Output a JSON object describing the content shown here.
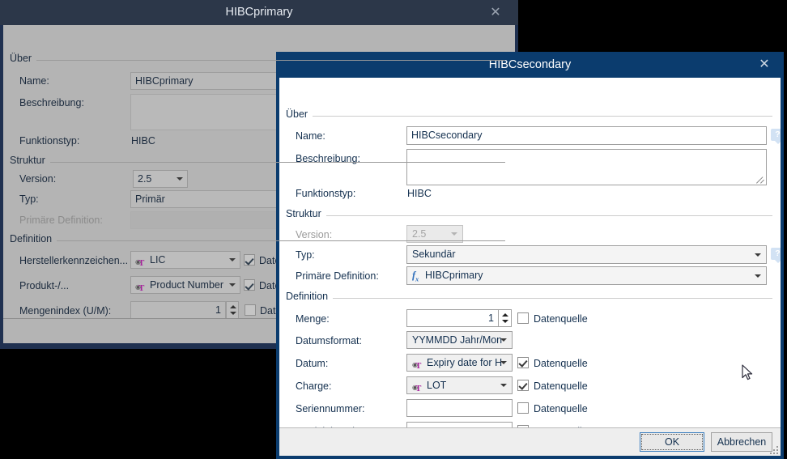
{
  "background_window": {
    "title": "HIBCprimary",
    "close_icon": "close-icon",
    "groups": {
      "about": "Über",
      "structure": "Struktur",
      "definition": "Definition"
    },
    "fields": {
      "name_label": "Name:",
      "name_value": "HIBCprimary",
      "description_label": "Beschreibung:",
      "description_value": "",
      "functiontype_label": "Funktionstyp:",
      "functiontype_value": "HIBC",
      "version_label": "Version:",
      "version_value": "2.5",
      "type_label": "Typ:",
      "type_value": "Primär",
      "primary_def_label": "Primäre Definition:",
      "primary_def_value": "",
      "lic_label": "Herstellerkennzeichen...",
      "lic_value": "LIC",
      "product_label": "Produkt-/...",
      "product_value": "Product Number",
      "uom_label": "Mengenindex (U/M):",
      "uom_value": "1",
      "datasource_label": "Date"
    },
    "checkboxes": [
      {
        "label": "Date",
        "checked": true
      },
      {
        "label": "Date",
        "checked": true
      },
      {
        "label": "Date",
        "checked": false
      }
    ]
  },
  "dialog": {
    "title": "HIBCsecondary",
    "close_icon": "close-icon",
    "groups": {
      "about": "Über",
      "structure": "Struktur",
      "definition": "Definition"
    },
    "about": {
      "name_label": "Name:",
      "name_value": "HIBCsecondary",
      "name_placeholder": "",
      "description_label": "Beschreibung:",
      "description_value": "",
      "functiontype_label": "Funktionstyp:",
      "functiontype_value": "HIBC",
      "help_icon": "?"
    },
    "structure": {
      "version_label": "Version:",
      "version_value": "2.5",
      "type_label": "Typ:",
      "type_value": "Sekundär",
      "primary_def_label": "Primäre Definition:",
      "primary_def_value": "HIBCprimary",
      "primary_def_icon": "fx-icon",
      "help_icon": "?"
    },
    "definition": {
      "rows": [
        {
          "label": "Menge:",
          "value": "1",
          "control": "spinner",
          "datasource_label": "Datenquelle",
          "checked": false
        },
        {
          "label": "Datumsformat:",
          "value": "YYMMDD Jahr/Mon",
          "control": "combo-small",
          "datasource_label": "",
          "checked": null
        },
        {
          "label": "Datum:",
          "value": "Expiry date for H",
          "control": "combo-icon",
          "datasource_label": "Datenquelle",
          "checked": true
        },
        {
          "label": "Charge:",
          "value": "LOT",
          "control": "combo-icon",
          "datasource_label": "Datenquelle",
          "checked": true
        },
        {
          "label": "Seriennummer:",
          "value": "",
          "control": "text",
          "datasource_label": "Datenquelle",
          "checked": false
        },
        {
          "label": "Produktionsdatum:",
          "value": "",
          "control": "text",
          "datasource_label": "Datenquelle",
          "checked": false
        }
      ]
    },
    "footer": {
      "ok_label": "OK",
      "cancel_label": "Abbrechen"
    }
  },
  "colors": {
    "dialog_titlebar": "#0b3c6e",
    "background_titlebar": "#2c3749",
    "background_body": "#b4b4b4",
    "accent_focus": "#3a7ebf",
    "icon_magenta": "#a5219b",
    "icon_blue": "#2f6fbb",
    "help_badge": "#d2e2f4"
  }
}
